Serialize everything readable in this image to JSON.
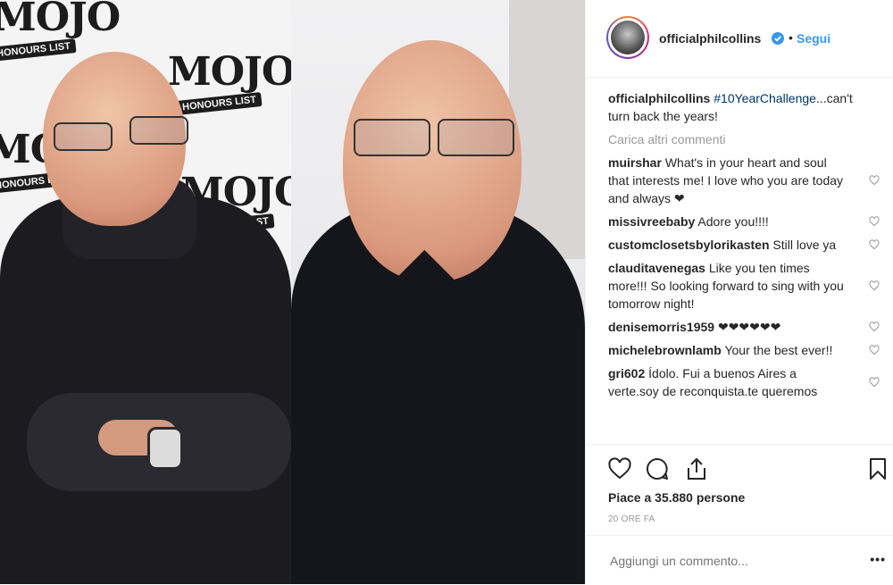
{
  "post_image": {
    "left_backdrop": {
      "logo_text": "MOJO",
      "banner_text": "HONOURS LIST"
    }
  },
  "header": {
    "username": "officialphilcollins",
    "separator": "•",
    "follow_label": "Segui"
  },
  "caption": {
    "username": "officialphilcollins",
    "hashtag": "#10YearChallenge",
    "text": "...can't turn back the years!"
  },
  "load_more_label": "Carica altri commenti",
  "comments": [
    {
      "user": "muirshar",
      "text": "What's in your heart and soul that interests me! I love who you are today and always ❤"
    },
    {
      "user": "missivreebaby",
      "text": "Adore you!!!!"
    },
    {
      "user": "customclosetsbylorikasten",
      "text": "Still love ya"
    },
    {
      "user": "clauditavenegas",
      "text": "Like you ten times more!!! So looking forward to sing with you tomorrow night!"
    },
    {
      "user": "denisemorris1959",
      "text": "❤❤❤❤❤❤"
    },
    {
      "user": "michelebrownlamb",
      "text": "Your the best ever!!"
    },
    {
      "user": "gri602",
      "text": "Ídolo. Fui a buenos Aires a verte.soy de reconquista.te queremos"
    }
  ],
  "likes_text": "Piace a 35.880 persone",
  "timestamp": "20 ORE FA",
  "add_comment_placeholder": "Aggiungi un commento...",
  "more_label": "•••",
  "icons": {
    "like": "heart-icon",
    "comment": "comment-bubble-icon",
    "share": "share-icon",
    "save": "bookmark-icon",
    "verified": "verified-badge-icon"
  },
  "colors": {
    "link_blue": "#3897f0",
    "hashtag": "#003569",
    "muted": "#999999",
    "text": "#262626"
  }
}
